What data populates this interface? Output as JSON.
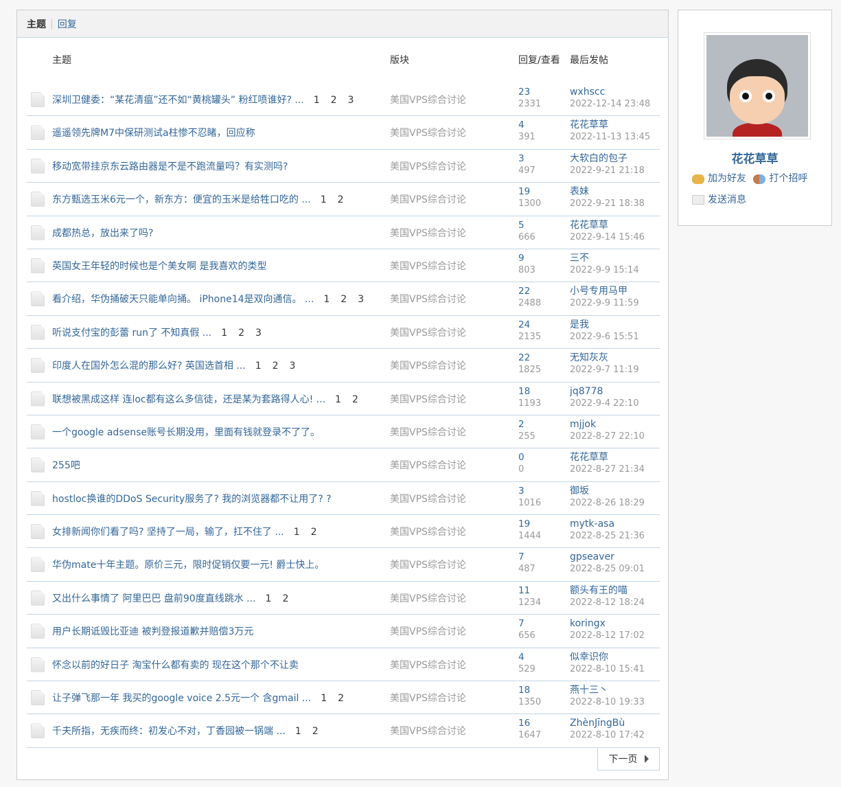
{
  "tabs": {
    "topics": "主题",
    "replies": "回复"
  },
  "header": {
    "topic": "主题",
    "forum": "版块",
    "counts": "回复/查看",
    "last": "最后发帖"
  },
  "rows": [
    {
      "title": "深圳卫健委：“某花清瘟”还不如“黄桃罐头” 粉红喷谁好? ...",
      "pages": [
        "1",
        "2",
        "3"
      ],
      "forum": "美国VPS综合讨论",
      "replies": "23",
      "views": "2331",
      "user": "wxhscc",
      "time": "2022-12-14 23:48"
    },
    {
      "title": "遥遥领先牌M7中保研测试a柱惨不忍睹，回应称",
      "pages": [],
      "forum": "美国VPS综合讨论",
      "replies": "4",
      "views": "391",
      "user": "花花草草",
      "time": "2022-11-13 13:45"
    },
    {
      "title": "移动宽带挂京东云路由器是不是不跑流量吗？有实测吗?",
      "pages": [],
      "forum": "美国VPS综合讨论",
      "replies": "3",
      "views": "497",
      "user": "大软白的包子",
      "time": "2022-9-21 21:18"
    },
    {
      "title": "东方甄选玉米6元一个，新东方：便宜的玉米是给牲口吃的 ...",
      "pages": [
        "1",
        "2"
      ],
      "forum": "美国VPS综合讨论",
      "replies": "19",
      "views": "1300",
      "user": "表妹",
      "time": "2022-9-21 18:38"
    },
    {
      "title": "成都热总，放出来了吗?",
      "pages": [],
      "forum": "美国VPS综合讨论",
      "replies": "5",
      "views": "666",
      "user": "花花草草",
      "time": "2022-9-14 15:46"
    },
    {
      "title": "英国女王年轻的时候也是个美女啊 是我喜欢的类型",
      "pages": [],
      "forum": "美国VPS综合讨论",
      "replies": "9",
      "views": "803",
      "user": "三不",
      "time": "2022-9-9 15:14"
    },
    {
      "title": "看介绍，华伪捅破天只能单向捅。 iPhone14是双向通信。 ...",
      "pages": [
        "1",
        "2",
        "3"
      ],
      "forum": "美国VPS综合讨论",
      "replies": "22",
      "views": "2488",
      "user": "小号专用马甲",
      "time": "2022-9-9 11:59"
    },
    {
      "title": "听说支付宝的彭蕾 run了 不知真假 ...",
      "pages": [
        "1",
        "2",
        "3"
      ],
      "forum": "美国VPS综合讨论",
      "replies": "24",
      "views": "2135",
      "user": "是我",
      "time": "2022-9-6 15:51"
    },
    {
      "title": "印度人在国外怎么混的那么好? 英国选首相 ...",
      "pages": [
        "1",
        "2",
        "3"
      ],
      "forum": "美国VPS综合讨论",
      "replies": "22",
      "views": "1825",
      "user": "无知灰灰",
      "time": "2022-9-7 11:19"
    },
    {
      "title": "联想被黑成这样 连loc都有这么多信徒，还是某为套路得人心! ...",
      "pages": [
        "1",
        "2"
      ],
      "forum": "美国VPS综合讨论",
      "replies": "18",
      "views": "1193",
      "user": "jq8778",
      "time": "2022-9-4 22:10"
    },
    {
      "title": "一个google adsense账号长期没用，里面有钱就登录不了了。",
      "pages": [],
      "forum": "美国VPS综合讨论",
      "replies": "2",
      "views": "255",
      "user": "mjjok",
      "time": "2022-8-27 22:10"
    },
    {
      "title": "255吧",
      "pages": [],
      "forum": "美国VPS综合讨论",
      "replies": "0",
      "views": "0",
      "user": "花花草草",
      "time": "2022-8-27 21:34"
    },
    {
      "title": "hostloc换谁的DDoS Security服务了?  我的浏览器都不让用了? ?",
      "pages": [],
      "forum": "美国VPS综合讨论",
      "replies": "3",
      "views": "1016",
      "user": "御坂",
      "time": "2022-8-26 18:29"
    },
    {
      "title": "女排新闻你们看了吗? 坚持了一局，输了，扛不住了 ...",
      "pages": [
        "1",
        "2"
      ],
      "forum": "美国VPS综合讨论",
      "replies": "19",
      "views": "1444",
      "user": "mytk-asa",
      "time": "2022-8-25 21:36"
    },
    {
      "title": "华伪mate十年主题。原价三元，限时促销仅要一元! 爵士快上。",
      "pages": [],
      "forum": "美国VPS综合讨论",
      "replies": "7",
      "views": "487",
      "user": "gpseaver",
      "time": "2022-8-25 09:01"
    },
    {
      "title": "又出什么事情了 阿里巴巴 盘前90度直线跳水 ...",
      "pages": [
        "1",
        "2"
      ],
      "forum": "美国VPS综合讨论",
      "replies": "11",
      "views": "1234",
      "user": "额头有王的喵",
      "time": "2022-8-12 18:24"
    },
    {
      "title": "用户长期诋毁比亚迪 被判登报道歉并赔偿3万元",
      "pages": [],
      "forum": "美国VPS综合讨论",
      "replies": "7",
      "views": "656",
      "user": "koringx",
      "time": "2022-8-12 17:02"
    },
    {
      "title": "怀念以前的好日子 淘宝什么都有卖的 现在这个那个不让卖",
      "pages": [],
      "forum": "美国VPS综合讨论",
      "replies": "4",
      "views": "529",
      "user": "似幸识你",
      "time": "2022-8-10 15:41"
    },
    {
      "title": "让子弹飞那一年 我买的google voice 2.5元一个 含gmail ...",
      "pages": [
        "1",
        "2"
      ],
      "forum": "美国VPS综合讨论",
      "replies": "18",
      "views": "1350",
      "user": "燕十三丶",
      "time": "2022-8-10 19:33"
    },
    {
      "title": "千夫所指，无疾而终：初发心不对，丁香园被一锅端 ...",
      "pages": [
        "1",
        "2"
      ],
      "forum": "美国VPS综合讨论",
      "replies": "16",
      "views": "1647",
      "user": "ZhènJīngBù",
      "time": "2022-8-10 17:42"
    }
  ],
  "pager": {
    "next": "下一页"
  },
  "profile": {
    "name": "花花草草",
    "add_friend": "加为好友",
    "poke": "打个招呼",
    "message": "发送消息"
  }
}
